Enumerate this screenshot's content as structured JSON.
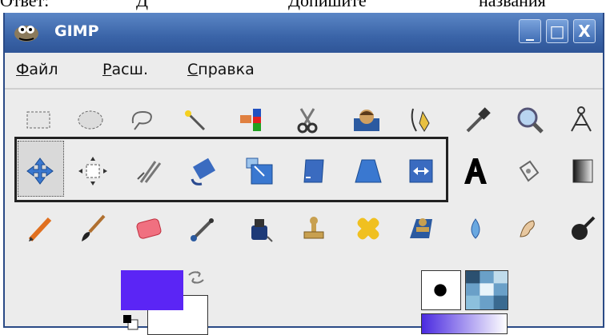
{
  "doc_text": [
    "Ответ:",
    "Д",
    "Допишите",
    "названия"
  ],
  "window": {
    "title": "GIMP",
    "buttons": {
      "minimize": "_",
      "maximize": "□",
      "close": "X"
    }
  },
  "menu": {
    "items": [
      {
        "underline": "Ф",
        "rest": "айл"
      },
      {
        "underline": "Р",
        "rest": "асш."
      },
      {
        "underline": "С",
        "rest": "правка"
      }
    ]
  },
  "toolbox": {
    "rows": [
      [
        "rect-select-icon",
        "ellipse-select-icon",
        "free-select-icon",
        "fuzzy-select-icon",
        "select-by-color-icon",
        "scissors-select-icon",
        "foreground-select-icon",
        "paths-icon",
        "color-picker-icon",
        "zoom-icon",
        "measure-icon"
      ],
      [
        "move-icon",
        "align-icon",
        "crop-icon",
        "rotate-icon",
        "scale-icon",
        "shear-icon",
        "perspective-icon",
        "flip-icon",
        "text-icon",
        "bucket-fill-icon",
        "blend-icon"
      ],
      [
        "pencil-icon",
        "paintbrush-icon",
        "eraser-icon",
        "airbrush-icon",
        "ink-icon",
        "clone-icon",
        "heal-icon",
        "perspective-clone-icon",
        "blur-icon",
        "smudge-icon",
        "dodge-burn-icon"
      ]
    ],
    "highlighted_row": 1
  },
  "colors": {
    "foreground": "#5b25f5",
    "background": "#ffffff"
  },
  "brush": {
    "shape": "circle"
  },
  "gradient": {
    "from": "#4a2ae0",
    "to": "#ffffff"
  }
}
